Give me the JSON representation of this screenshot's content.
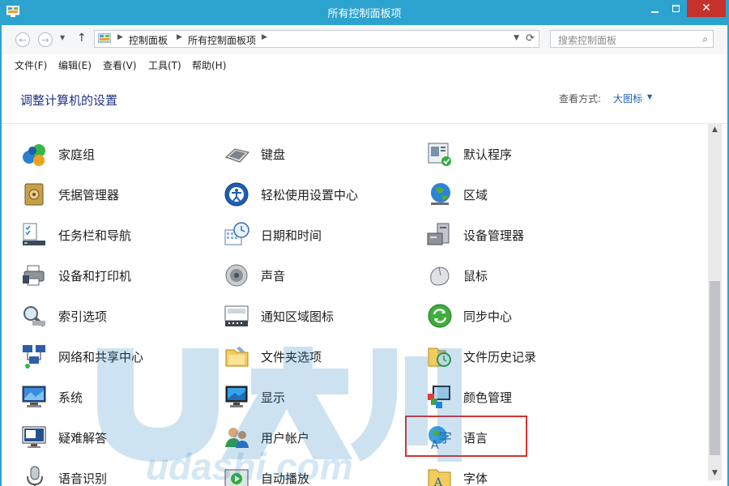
{
  "window": {
    "title": "所有控制面板项",
    "close_glyph": "✕"
  },
  "nav": {
    "back_glyph": "←",
    "forward_glyph": "→",
    "up_glyph": "↑",
    "dropdown_glyph": "▼",
    "refresh_glyph": "⟳"
  },
  "address": {
    "crumbs": [
      "控制面板",
      "所有控制面板项"
    ],
    "separator": "▶"
  },
  "search": {
    "placeholder": "搜索控制面板",
    "icon_glyph": "⌕"
  },
  "menu": [
    "文件(F)",
    "编辑(E)",
    "查看(V)",
    "工具(T)",
    "帮助(H)"
  ],
  "header": {
    "title": "调整计算机的设置",
    "view_label": "查看方式:",
    "view_value": "大图标",
    "view_arrow": "▼"
  },
  "items": [
    {
      "label": "家庭组",
      "icon": "homegroup-icon"
    },
    {
      "label": "键盘",
      "icon": "keyboard-icon"
    },
    {
      "label": "默认程序",
      "icon": "default-programs-icon"
    },
    {
      "label": "凭据管理器",
      "icon": "credential-manager-icon"
    },
    {
      "label": "轻松使用设置中心",
      "icon": "ease-of-access-icon"
    },
    {
      "label": "区域",
      "icon": "region-globe-icon"
    },
    {
      "label": "任务栏和导航",
      "icon": "taskbar-icon"
    },
    {
      "label": "日期和时间",
      "icon": "date-time-icon"
    },
    {
      "label": "设备管理器",
      "icon": "device-manager-icon"
    },
    {
      "label": "设备和打印机",
      "icon": "devices-printers-icon"
    },
    {
      "label": "声音",
      "icon": "sound-speaker-icon"
    },
    {
      "label": "鼠标",
      "icon": "mouse-icon"
    },
    {
      "label": "索引选项",
      "icon": "indexing-options-icon"
    },
    {
      "label": "通知区域图标",
      "icon": "notification-area-icon"
    },
    {
      "label": "同步中心",
      "icon": "sync-center-icon"
    },
    {
      "label": "网络和共享中心",
      "icon": "network-sharing-icon"
    },
    {
      "label": "文件夹选项",
      "icon": "folder-options-icon"
    },
    {
      "label": "文件历史记录",
      "icon": "file-history-icon"
    },
    {
      "label": "系统",
      "icon": "system-icon"
    },
    {
      "label": "显示",
      "icon": "display-icon"
    },
    {
      "label": "颜色管理",
      "icon": "color-management-icon"
    },
    {
      "label": "疑难解答",
      "icon": "troubleshooting-icon"
    },
    {
      "label": "用户帐户",
      "icon": "user-accounts-icon"
    },
    {
      "label": "语言",
      "icon": "language-icon"
    },
    {
      "label": "语音识别",
      "icon": "speech-recognition-icon"
    },
    {
      "label": "自动播放",
      "icon": "autoplay-icon"
    },
    {
      "label": "字体",
      "icon": "fonts-icon"
    }
  ],
  "scrollbar": {
    "up_glyph": "▲",
    "down_glyph": "▼"
  },
  "watermark": {
    "logo_text": "U大师",
    "url_text": "www.udashi.com"
  },
  "colors": {
    "titlebar": "#2ca3cf",
    "close": "#c7312c",
    "title_text": "#1e3287",
    "link": "#1a5fb4",
    "highlight": "#d93030"
  }
}
